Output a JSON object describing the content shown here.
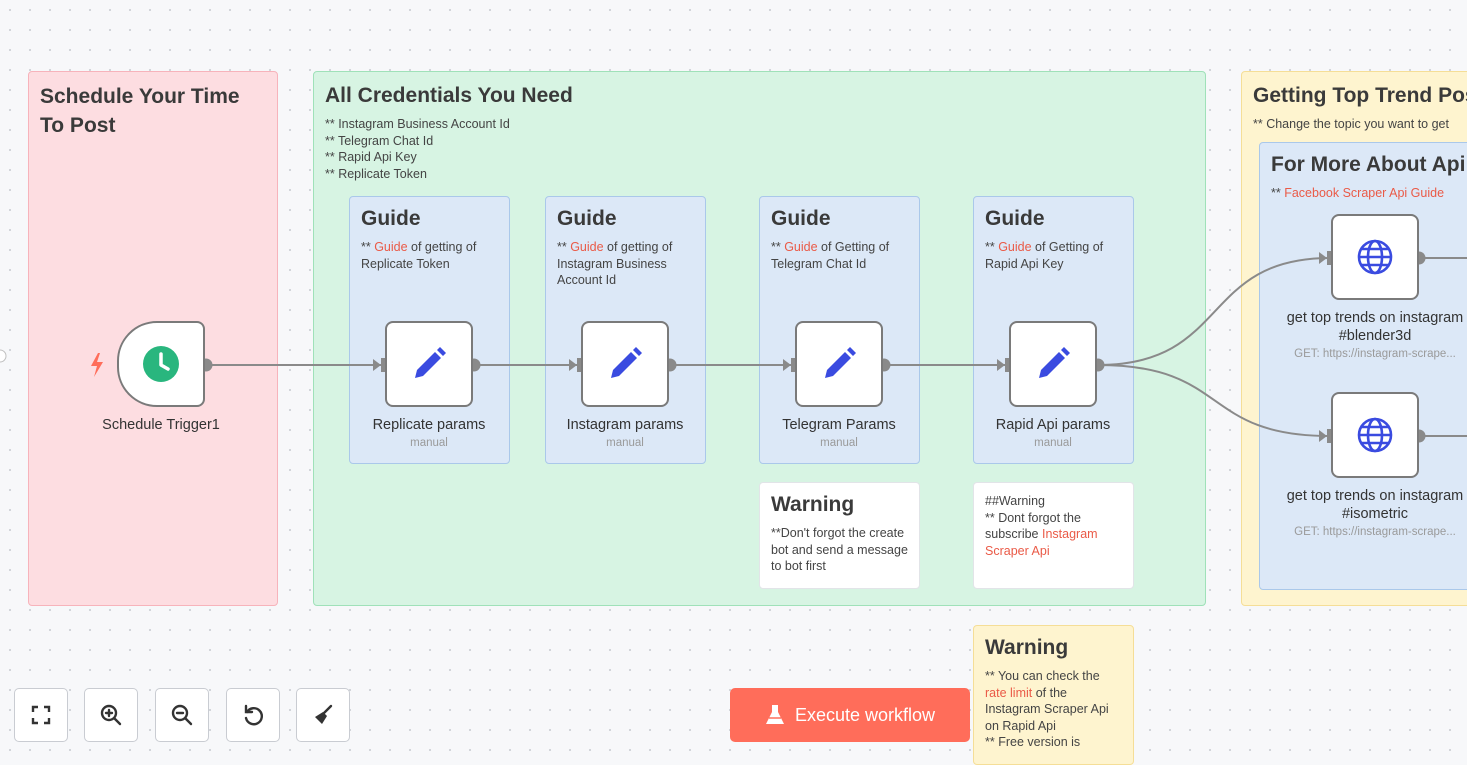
{
  "sticky_schedule": {
    "title": "Schedule Your Time To Post"
  },
  "sticky_credentials": {
    "title": "All Credentials You Need",
    "lines": "** Instagram Business Account Id\n** Telegram Chat Id\n** Rapid Api Key\n** Replicate Token"
  },
  "guides": [
    {
      "title": "Guide",
      "prefix": "** ",
      "link": "Guide",
      "text": " of getting of Replicate Token"
    },
    {
      "title": "Guide",
      "prefix": "** ",
      "link": "Guide",
      "text": " of getting of Instagram Business Account Id"
    },
    {
      "title": "Guide",
      "prefix": "** ",
      "link": "Guide",
      "text": " of Getting of Telegram Chat Id"
    },
    {
      "title": "Guide",
      "prefix": "** ",
      "link": "Guide",
      "text": " of Getting of Rapid Api Key"
    }
  ],
  "warning_telegram": {
    "title": "Warning",
    "text": "**Don't forgot the create bot and send a message to bot first"
  },
  "warning_subscribe": {
    "text": "##Warning\n** Dont forgot the subscribe ",
    "link": "Instagram Scraper Api"
  },
  "warning_rate": {
    "title": "Warning",
    "prefix": "** You can check the ",
    "link": "rate limit",
    "text": " of the Instagram Scraper Api on Rapid Api\n** Free version is"
  },
  "sticky_trends": {
    "title": "Getting Top Trend Pos",
    "text": "** Change the topic you want to get"
  },
  "sticky_api": {
    "title": "For More About Api",
    "prefix": "** ",
    "link": "Facebook Scraper Api Guide"
  },
  "nodes": [
    {
      "id": "schedule-trigger",
      "label": "Schedule Trigger1",
      "sub": ""
    },
    {
      "id": "replicate-params",
      "label": "Replicate params",
      "sub": "manual"
    },
    {
      "id": "instagram-params",
      "label": "Instagram params",
      "sub": "manual"
    },
    {
      "id": "telegram-params",
      "label": "Telegram Params",
      "sub": "manual"
    },
    {
      "id": "rapid-api-params",
      "label": "Rapid Api params",
      "sub": "manual"
    },
    {
      "id": "trends-blender3d",
      "label": "get top trends on instagram #blender3d",
      "sub": "GET: https://instagram-scrape..."
    },
    {
      "id": "trends-isometric",
      "label": "get top trends on instagram #isometric",
      "sub": "GET: https://instagram-scrape..."
    }
  ],
  "toolbar": {
    "fit_view": "fit-view-icon",
    "zoom_in": "zoom-in-icon",
    "zoom_out": "zoom-out-icon",
    "reset": "undo-icon",
    "tidy": "broom-icon"
  },
  "execute_label": "Execute workflow",
  "colors": {
    "accent": "#ff6d5a",
    "trigger_green": "#29b67e",
    "icon_blue": "#3a4be0",
    "link": "#ea5a47"
  }
}
